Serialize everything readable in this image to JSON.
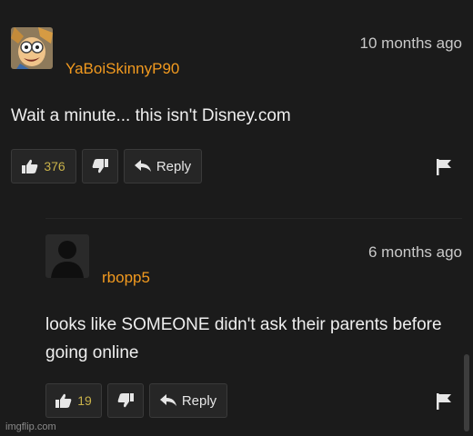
{
  "comments": [
    {
      "username": "YaBoiSkinnyP90",
      "time": "10 months ago",
      "text": "Wait a minute... this isn't Disney.com",
      "likes": "376",
      "reply_label": "Reply"
    },
    {
      "username": "rbopp5",
      "time": "6 months ago",
      "text": "looks like SOMEONE didn't ask their parents before going online",
      "likes": "19",
      "reply_label": "Reply"
    }
  ],
  "watermark": "imgflip.com",
  "colors": {
    "background": "#1b1b1b",
    "username": "#f29a1f",
    "count": "#c9b24a"
  },
  "icons": [
    "thumbs-up-icon",
    "thumbs-down-icon",
    "reply-arrow-icon",
    "flag-icon"
  ]
}
